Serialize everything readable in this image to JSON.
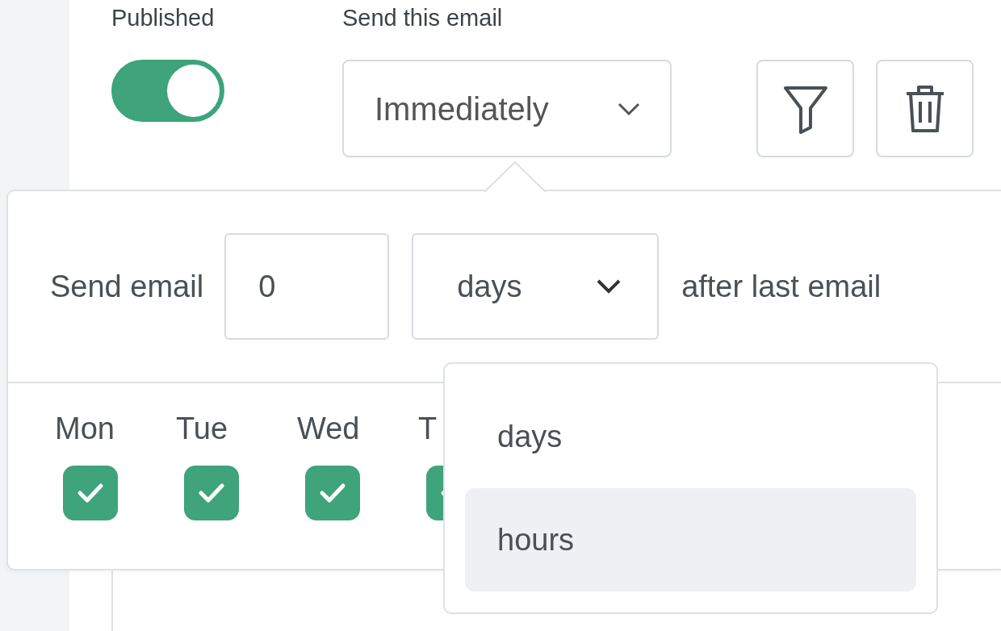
{
  "published": {
    "label": "Published",
    "on": true
  },
  "send_this_email": {
    "label": "Send this email",
    "value": "Immediately"
  },
  "schedule": {
    "prefix": "Send email",
    "amount": "0",
    "unit": "days",
    "suffix": "after last email",
    "unit_open": true
  },
  "unit_options": [
    {
      "label": "days",
      "highlighted": false
    },
    {
      "label": "hours",
      "highlighted": true
    }
  ],
  "days": [
    {
      "label": "Mon",
      "checked": true
    },
    {
      "label": "Tue",
      "checked": true
    },
    {
      "label": "Wed",
      "checked": true
    },
    {
      "label": "T",
      "checked": true
    }
  ]
}
